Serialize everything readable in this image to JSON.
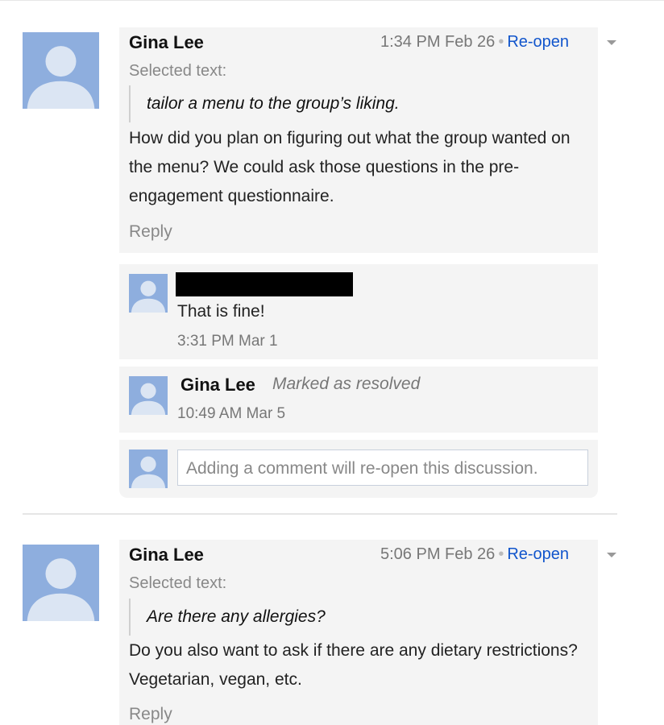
{
  "threads": [
    {
      "author": "Gina Lee",
      "timestamp": "1:34 PM Feb 26",
      "reopen_label": "Re-open",
      "selected_label": "Selected text:",
      "quote": "tailor a menu to the group’s liking.",
      "comment": "How did you plan on figuring out what the group wanted on the menu? We could ask those questions in the pre-engagement questionnaire.",
      "reply_label": "Reply",
      "replies": [
        {
          "author": "",
          "text": "That is fine!",
          "timestamp": "3:31 PM Mar 1"
        },
        {
          "author": "Gina Lee",
          "status": "Marked as resolved",
          "timestamp": "10:49 AM Mar 5"
        }
      ],
      "new_comment_placeholder": "Adding a comment will re-open this discussion."
    },
    {
      "author": "Gina Lee",
      "timestamp": "5:06 PM Feb 26",
      "reopen_label": "Re-open",
      "selected_label": "Selected text:",
      "quote": "Are there any allergies?",
      "comment": "Do you also want to ask if there are any dietary restrictions? Vegetarian, vegan, etc.",
      "reply_label": "Reply"
    }
  ],
  "colors": {
    "avatar": "#8eaede",
    "card_bg": "#f4f4f4",
    "link": "#1155cc"
  },
  "icons": {
    "avatar": "default-user-silhouette-icon",
    "menu": "chevron-down-icon"
  }
}
